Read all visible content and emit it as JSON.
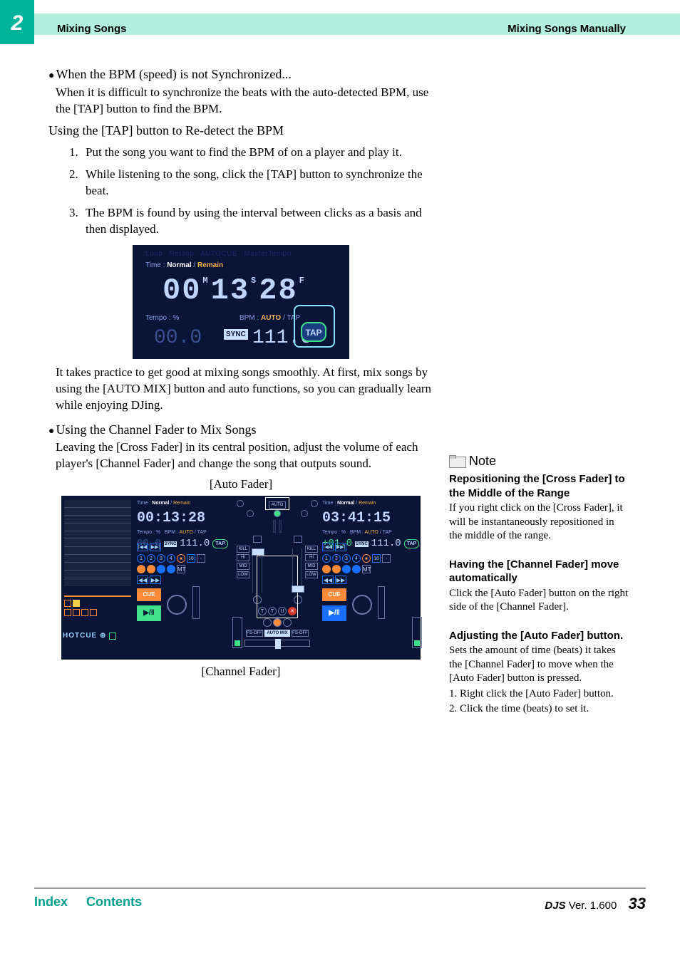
{
  "header": {
    "chapter_num": "2",
    "left": "Mixing Songs",
    "right": "Mixing Songs Manually"
  },
  "section1": {
    "heading": "When the BPM (speed) is not Synchronized...",
    "para": "When it is difficult to synchronize the beats with the auto-detected BPM, use the [TAP] button to find the BPM.",
    "subhead": "Using the [TAP] button to Re-detect the BPM",
    "steps": [
      "Put the song you want to find the BPM of on a player and play it.",
      "While listening to the song, click the [TAP] button to synchronize the beat.",
      "The BPM is found by using the interval between clicks as a basis and then displayed."
    ]
  },
  "fig1": {
    "toprow": [
      "Loop",
      "Reloop",
      "AUTOCUE",
      "MasterTempo"
    ],
    "time_label": "Time :",
    "normal": "Normal",
    "sep": " / ",
    "remain": "Remain",
    "m_label": "M",
    "s_label": "S",
    "f_label": "F",
    "time_value": "00:13:28",
    "tempo_label": "Tempo : %",
    "bpm_label": "BPM :",
    "auto": "AUTO",
    "tap_mode": "TAP",
    "tempo_value": "00.0",
    "sync": "SYNC",
    "bpm_value": "111.0",
    "tap_btn": "TAP"
  },
  "para_practice": "It takes practice to get good at mixing songs smoothly. At first, mix songs by using the [AUTO MIX] button and auto functions, so you can gradually learn while enjoying DJing.",
  "section2": {
    "heading": "Using the Channel Fader to Mix Songs",
    "para": "Leaving the [Cross Fader] in its central position, adjust the volume of each player's [Channel Fader] and change the song that outputs sound."
  },
  "fig2": {
    "caption1": "[Auto Fader]",
    "caption2": "[Channel Fader]",
    "deckA_time": "00:13:28",
    "deckB_time": "03:41:15",
    "time_label": "Time :",
    "normal": "Normal",
    "sep": " / ",
    "remain": "Remain",
    "tempo_label": "Tempo : %",
    "bpm_label": "BPM :",
    "auto": "AUTO",
    "tap": "TAP",
    "deckA_tempo": "00.0",
    "deckB_tempo": "+01.0",
    "sync": "SYNC",
    "bpm_value": "111.0",
    "tap_btn": "TAP",
    "trans_prev": "|◀◀",
    "trans_next": "▶▶|",
    "nav_rew": "◀◀",
    "nav_ff": "▶▶",
    "nums": [
      "1",
      "2",
      "3",
      "4"
    ],
    "loop_16": "16",
    "mt": "MT",
    "cue": "CUE",
    "play": "▶/‖",
    "auto_box": "AUTO",
    "eq_labels": [
      "KILL",
      "HI",
      "MID",
      "LOW"
    ],
    "fs_off": "FS-OFF",
    "auto_mix": "AUTO MIX",
    "hotcue": "HOTCUE",
    "rec_on": "●"
  },
  "sidebar": {
    "note": "Note",
    "h1": "Repositioning the [Cross Fader] to the Middle of the Range",
    "p1": "If you right click on the [Cross Fader], it will be instantaneously repositioned in the middle of the range.",
    "h2": "Having the [Channel Fader] move automatically",
    "p2": "Click the [Auto Fader] button on the right side of the [Channel Fader].",
    "h3": "Adjusting the [Auto Fader] button.",
    "p3": "Sets the amount of time (beats) it takes the [Channel Fader] to move when the [Auto Fader] button is pressed.",
    "p4": "1. Right click the [Auto Fader] button.",
    "p5": "2. Click the time (beats) to set it."
  },
  "footer": {
    "index": "Index",
    "contents": "Contents",
    "product": "DJS",
    "ver_label": " Ver. 1.600",
    "page": "33"
  }
}
